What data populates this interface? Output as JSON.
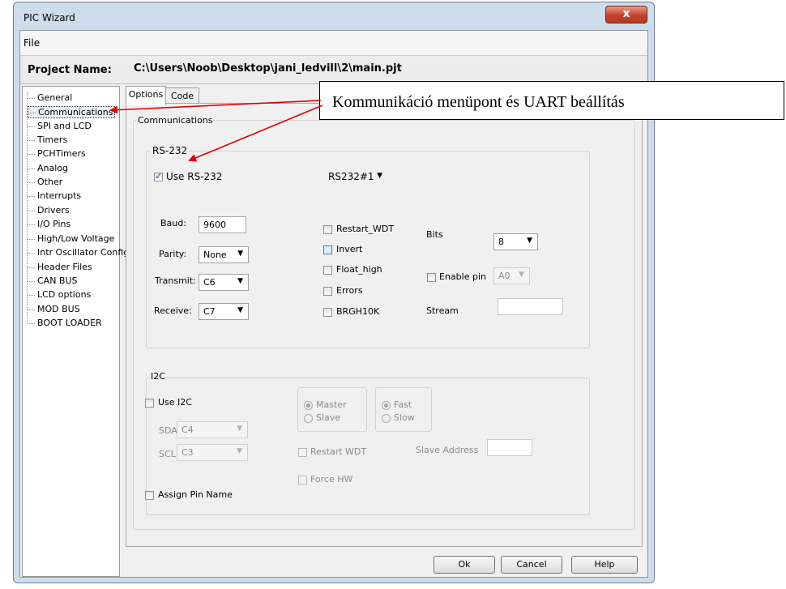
{
  "window": {
    "title": "PIC Wizard",
    "close_glyph": "x"
  },
  "menu": {
    "file": "File"
  },
  "project": {
    "label": "Project Name:",
    "path": "C:\\Users\\Noob\\Desktop\\jani_ledvill\\2\\main.pjt"
  },
  "tree": {
    "items": [
      "General",
      "Communications",
      "SPI and LCD",
      "Timers",
      "PCHTimers",
      "Analog",
      "Other",
      "Interrupts",
      "Drivers",
      "I/O Pins",
      "High/Low Voltage",
      "Intr Oscillator Config",
      "Header Files",
      "CAN BUS",
      "LCD options",
      "MOD BUS",
      "BOOT LOADER"
    ],
    "selected": "Communications"
  },
  "tabs": {
    "options": "Options",
    "code": "Code"
  },
  "panel": {
    "title": "Communications"
  },
  "rs232": {
    "group_label": "RS-232",
    "use_label": "Use RS-232",
    "use_checked": true,
    "port": "RS232#1",
    "baud_label": "Baud:",
    "baud": "9600",
    "parity_label": "Parity:",
    "parity": "None",
    "transmit_label": "Transmit:",
    "transmit": "C6",
    "receive_label": "Receive:",
    "receive": "C7",
    "restart_wdt": "Restart_WDT",
    "invert": "Invert",
    "float_high": "Float_high",
    "errors": "Errors",
    "brgh10k": "BRGH10K",
    "bits_label": "Bits",
    "bits": "8",
    "enable_pin_label": "Enable pin",
    "enable_pin": "A0",
    "stream_label": "Stream",
    "stream": ""
  },
  "i2c": {
    "group_label": "I2C",
    "use_label": "Use I2C",
    "sda_label": "SDA:",
    "sda": "C4",
    "scl_label": "SCL:",
    "scl": "C3",
    "master": "Master",
    "slave": "Slave",
    "fast": "Fast",
    "slow": "Slow",
    "restart_wdt": "Restart WDT",
    "force_hw": "Force HW",
    "slave_address_label": "Slave Address",
    "slave_address": "",
    "assign_pin_name": "Assign Pin Name"
  },
  "buttons": {
    "ok": "Ok",
    "cancel": "Cancel",
    "help": "Help"
  },
  "annotation": {
    "text": "Kommunikáció menüpont és UART beállítás"
  }
}
